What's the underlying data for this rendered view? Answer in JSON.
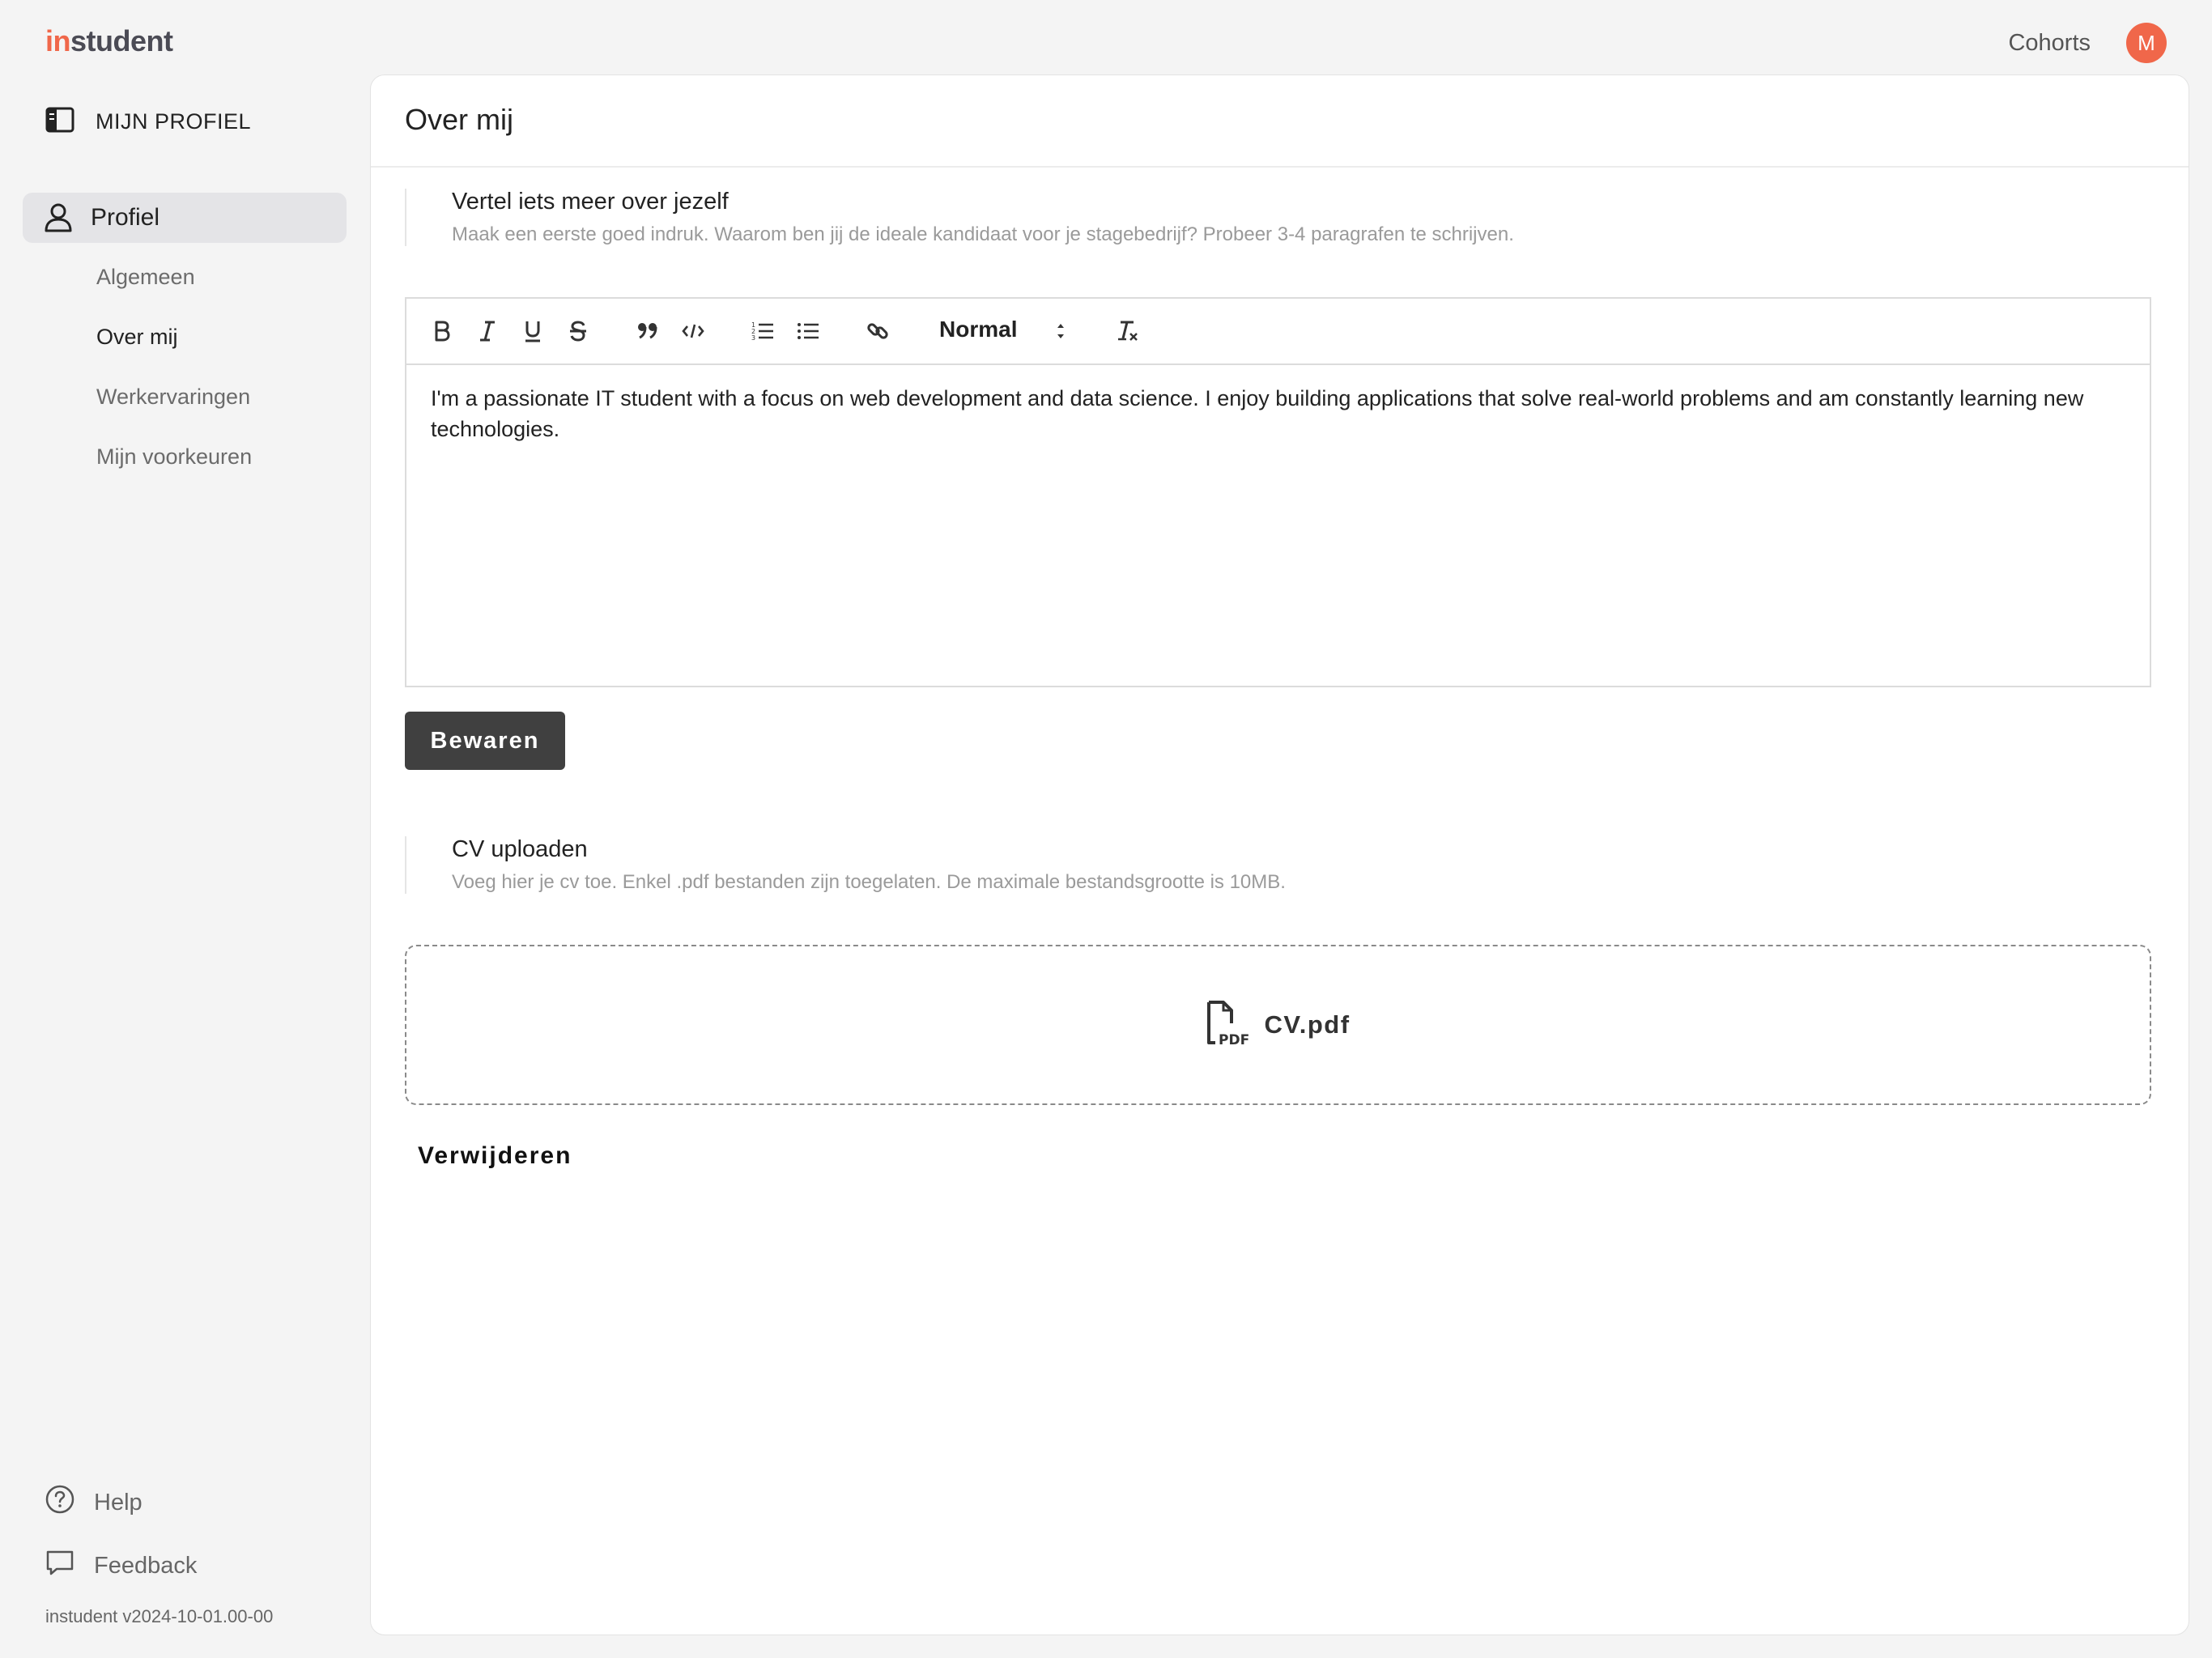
{
  "app": {
    "logo_in": "in",
    "logo_rest": "student",
    "version": "instudent v2024-10-01.00-00"
  },
  "topnav": {
    "cohorts_label": "Cohorts",
    "avatar_initial": "M",
    "avatar_color": "#f0674a"
  },
  "sidebar": {
    "header_label": "MIJN PROFIEL",
    "header_icon": "sidebar-panel-icon",
    "active_item": {
      "label": "Profiel",
      "icon": "user-icon"
    },
    "subitems": [
      {
        "label": "Algemeen",
        "active": false
      },
      {
        "label": "Over mij",
        "active": true
      },
      {
        "label": "Werkervaringen",
        "active": false
      },
      {
        "label": "Mijn voorkeuren",
        "active": false
      }
    ],
    "help_label": "Help",
    "feedback_label": "Feedback"
  },
  "main": {
    "title": "Over mij",
    "about_section": {
      "title": "Vertel iets meer over jezelf",
      "hint": "Maak een eerste goed indruk. Waarom ben jij de ideale kandidaat voor je stagebedrijf? Probeer 3-4 paragrafen te schrijven."
    },
    "editor": {
      "toolbar": [
        "bold",
        "italic",
        "underline",
        "strikethrough",
        "blockquote",
        "code",
        "ordered-list",
        "bullet-list",
        "link",
        "format-select",
        "clear-formatting"
      ],
      "format_value": "Normal",
      "content": "I'm a passionate IT student with a focus on web development and data science. I enjoy building applications that solve real-world problems and am constantly learning new technologies."
    },
    "save_label": "Bewaren",
    "cv_section": {
      "title": "CV uploaden",
      "hint": "Voeg hier je cv toe. Enkel .pdf bestanden zijn toegelaten. De maximale bestandsgrootte is 10MB."
    },
    "file": {
      "name": "CV.pdf",
      "icon": "pdf-file-icon",
      "icon_text": "PDF"
    },
    "delete_label": "Verwijderen"
  }
}
